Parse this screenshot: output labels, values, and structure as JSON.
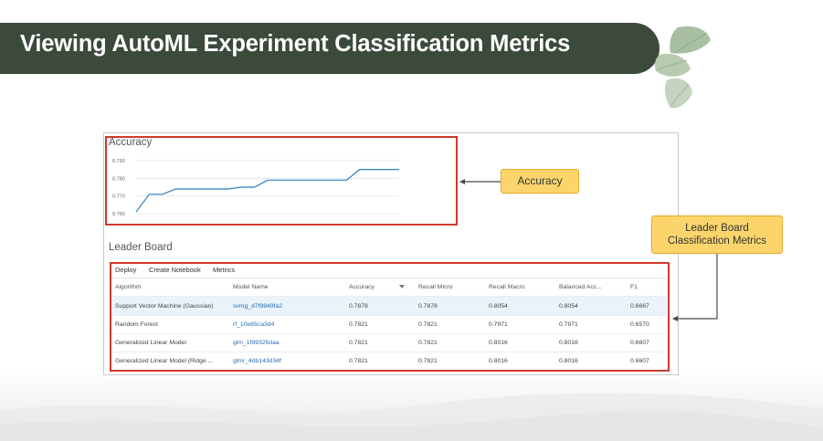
{
  "slide": {
    "title": "Viewing AutoML Experiment Classification Metrics"
  },
  "accuracy_panel": {
    "title": "Accuracy"
  },
  "chart_data": {
    "type": "line",
    "title": "Accuracy",
    "xlabel": "",
    "ylabel": "",
    "y_ticks": [
      "0.790",
      "0.780",
      "0.770",
      "0.760"
    ],
    "ylim": [
      0.758,
      0.791
    ],
    "x": [
      0,
      1,
      2,
      3,
      4,
      5,
      6,
      7,
      8,
      9,
      10,
      11,
      12,
      13,
      14,
      15,
      16,
      17,
      18,
      19,
      20
    ],
    "values": [
      0.761,
      0.771,
      0.771,
      0.774,
      0.774,
      0.774,
      0.774,
      0.774,
      0.775,
      0.775,
      0.779,
      0.779,
      0.779,
      0.779,
      0.779,
      0.779,
      0.779,
      0.785,
      0.785,
      0.785,
      0.785
    ],
    "line_color": "#2a7fc1",
    "grid": true
  },
  "leader_board": {
    "title": "Leader Board",
    "toolbar": {
      "deploy": "Deploy",
      "create_notebook": "Create Notebook",
      "metrics": "Metrics"
    },
    "columns": {
      "algorithm": "Algorithm",
      "model_name": "Model Name",
      "accuracy": "Accuracy",
      "recall_micro": "Recall Micro",
      "recall_macro": "Recall Macro",
      "balanced_acc": "Balanced Acc...",
      "f1": "F1"
    },
    "rows": [
      {
        "algorithm": "Support Vector Machine (Gaussian)",
        "model_name": "svmg_d7f9849fa2",
        "accuracy": "0.7878",
        "recall_micro": "0.7878",
        "recall_macro": "0.8054",
        "balanced_acc": "0.8054",
        "f1": "0.6667"
      },
      {
        "algorithm": "Random Forest",
        "model_name": "rf_10e65ca3d4",
        "accuracy": "0.7821",
        "recall_micro": "0.7821",
        "recall_macro": "0.7971",
        "balanced_acc": "0.7971",
        "f1": "0.6570"
      },
      {
        "algorithm": "Generalized Linear Model",
        "model_name": "glm_1f99325daa",
        "accuracy": "0.7821",
        "recall_micro": "0.7821",
        "recall_macro": "0.8016",
        "balanced_acc": "0.8016",
        "f1": "0.6607"
      },
      {
        "algorithm": "Generalized Linear Model (Ridge ...",
        "model_name": "glmr_4db143d34f",
        "accuracy": "0.7821",
        "recall_micro": "0.7821",
        "recall_macro": "0.8016",
        "balanced_acc": "0.8016",
        "f1": "0.6607"
      }
    ]
  },
  "callouts": {
    "accuracy": "Accuracy",
    "leader_board_line1": "Leader Board",
    "leader_board_line2": "Classification Metrics"
  },
  "colors": {
    "banner": "#3b4a3b",
    "highlight_box": "#cf3a2c",
    "callout_fill": "#fbd56b",
    "callout_border": "#e5a829",
    "link": "#2a6db3"
  }
}
